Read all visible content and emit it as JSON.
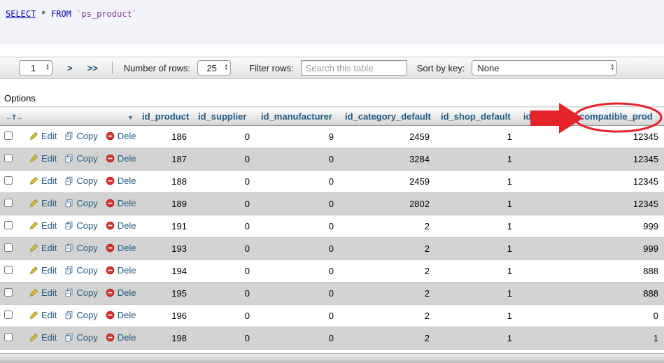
{
  "query": {
    "select": "SELECT",
    "star": "*",
    "from": "FROM",
    "table_ref": "`ps_product`"
  },
  "nav": {
    "page_value": "1",
    "next": ">",
    "last": ">>",
    "rows_label": "Number of rows:",
    "rows_value": "25",
    "filter_label": "Filter rows:",
    "filter_placeholder": "Search this table",
    "sort_label": "Sort by key:",
    "sort_value": "None"
  },
  "options_label": "Options",
  "table": {
    "toggle_text": "←T→",
    "sort_arrow": "▼",
    "actions": {
      "edit": "Edit",
      "copy": "Copy",
      "delete": "Delete"
    },
    "columns": [
      "id_product",
      "id_supplier",
      "id_manufacturer",
      "id_category_default",
      "id_shop_default",
      "id",
      "compatible_prod"
    ],
    "rows": [
      [
        186,
        0,
        9,
        2459,
        1,
        "",
        12345
      ],
      [
        187,
        0,
        0,
        3284,
        1,
        "",
        12345
      ],
      [
        188,
        0,
        0,
        2459,
        1,
        "",
        12345
      ],
      [
        189,
        0,
        0,
        2802,
        1,
        "",
        12345
      ],
      [
        191,
        0,
        0,
        2,
        1,
        "",
        999
      ],
      [
        193,
        0,
        0,
        2,
        1,
        "",
        999
      ],
      [
        194,
        0,
        0,
        2,
        1,
        "",
        888
      ],
      [
        195,
        0,
        0,
        2,
        1,
        "",
        888
      ],
      [
        196,
        0,
        0,
        2,
        1,
        "",
        0
      ],
      [
        198,
        0,
        0,
        2,
        1,
        "",
        1
      ]
    ]
  },
  "annotation": {
    "color": "#e5242a"
  },
  "colors": {
    "link": "#235a81",
    "even_row": "#d3d3d3",
    "header_text": "#235a81"
  }
}
